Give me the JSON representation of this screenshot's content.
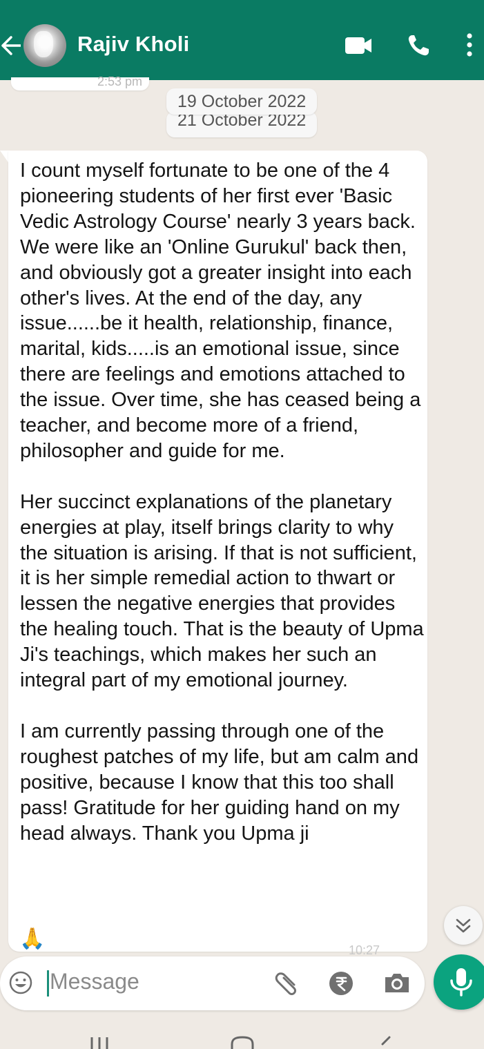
{
  "header": {
    "contact_name": "Rajiv Kholi",
    "bg_color": "#0a7b63",
    "icons": [
      "back-arrow-icon",
      "video-call-icon",
      "phone-icon",
      "more-vert-icon"
    ]
  },
  "chat": {
    "partial_time": "2:53 pm",
    "date_chips": [
      "19 October 2022",
      "21 October 2022"
    ],
    "message": {
      "paragraphs": [
        "I count myself fortunate to be one of the 4 pioneering students of her first ever 'Basic Vedic Astrology Course' nearly 3 years back. We were like an 'Online Gurukul' back then, and obviously got a greater insight into each other's lives. At the end of the day, any issue......be it health, relationship, finance, marital, kids.....is an emotional issue, since there are feelings and emotions attached to the issue. Over time, she has ceased being a teacher, and become more of a friend, philosopher and guide for me.",
        "Her succinct explanations of the planetary energies at play, itself brings clarity to why the situation is arising. If that is not sufficient, it is her simple remedial action to thwart or lessen the negative energies that provides the healing touch. That is the beauty of Upma Ji's teachings, which makes her such an integral part of my emotional journey.",
        "I am currently passing through one of the roughest patches of my life, but am calm and positive, because I know that this too shall pass! Gratitude for her guiding hand on my head always. Thank you Upma ji"
      ],
      "emoji": "🙏",
      "time_partial": "10:27"
    }
  },
  "composer": {
    "placeholder": "Message",
    "icons": [
      "emoji-icon",
      "attach-icon",
      "rupee-icon",
      "camera-icon",
      "mic-icon"
    ],
    "accent": "#0ba37f"
  },
  "system_nav": {
    "icons": [
      "recent-apps-icon",
      "home-icon",
      "back-icon"
    ]
  }
}
